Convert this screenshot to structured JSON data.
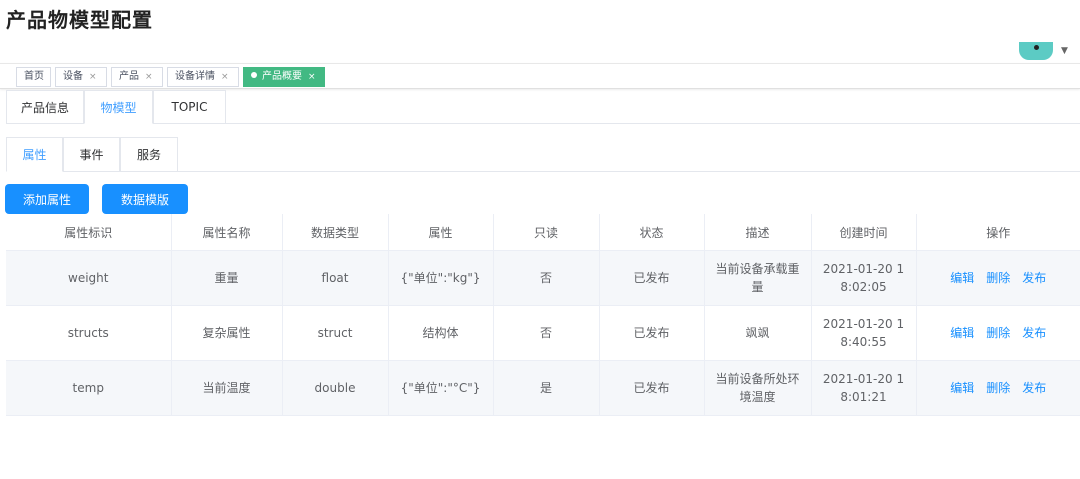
{
  "page": {
    "title": "产品物模型配置"
  },
  "tags": [
    {
      "label": "首页",
      "closable": false,
      "active": false
    },
    {
      "label": "设备",
      "closable": true,
      "active": false
    },
    {
      "label": "产品",
      "closable": true,
      "active": false
    },
    {
      "label": "设备详情",
      "closable": true,
      "active": false
    },
    {
      "label": "产品概要",
      "closable": true,
      "active": true
    }
  ],
  "tag_close_glyph": "×",
  "top_tabs": [
    "产品信息",
    "物模型",
    "TOPIC"
  ],
  "sub_tabs": [
    "属性",
    "事件",
    "服务"
  ],
  "buttons": {
    "add_property": "添加属性",
    "data_template": "数据模版"
  },
  "table": {
    "columns": [
      "属性标识",
      "属性名称",
      "数据类型",
      "属性",
      "只读",
      "状态",
      "描述",
      "创建时间",
      "操作"
    ],
    "rows": [
      {
        "id": "weight",
        "name": "重量",
        "type": "float",
        "attr": "{\"单位\":\"kg\"}",
        "readonly": "否",
        "status": "已发布",
        "desc": "当前设备承载重量",
        "created": "2021-01-20 18:02:05"
      },
      {
        "id": "structs",
        "name": "复杂属性",
        "type": "struct",
        "attr": "结构体",
        "readonly": "否",
        "status": "已发布",
        "desc": "飒飒",
        "created": "2021-01-20 18:40:55"
      },
      {
        "id": "temp",
        "name": "当前温度",
        "type": "double",
        "attr": "{\"单位\":\"°C\"}",
        "readonly": "是",
        "status": "已发布",
        "desc": "当前设备所处环境温度",
        "created": "2021-01-20 18:01:21"
      }
    ],
    "actions": [
      "编辑",
      "删除",
      "发布"
    ]
  },
  "colors": {
    "primary": "#1890ff",
    "tag_active": "#42b983",
    "tab_active_text": "#409eff",
    "avatar": "#5ccbc4"
  }
}
